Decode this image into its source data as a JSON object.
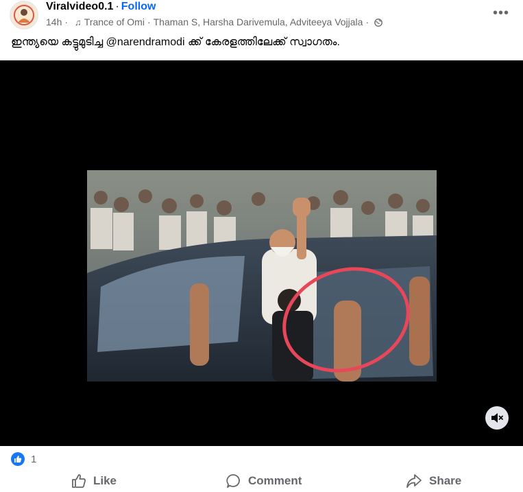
{
  "post": {
    "author": "Viralvideo0.1",
    "follow": "Follow",
    "time": "14h",
    "music": "Trance of Omi",
    "artists": "Thaman S, Harsha Darivemula, Adviteeya Vojjala",
    "dot": "·",
    "caption": "ഇന്ത്യയെ കട്ടുമുടിച്ച @narendramodi ക്ക് കേരളത്തിലേക്ക് സ്വാഗതം."
  },
  "reactions": {
    "count": "1"
  },
  "actions": {
    "like": "Like",
    "comment": "Comment",
    "share": "Share"
  },
  "icons": {
    "avatar": "avatar",
    "music": "music-note-icon",
    "globe": "globe-icon",
    "more": "more-options-icon",
    "mute": "muted-speaker-icon",
    "like_badge": "thumbs-up-icon",
    "like": "thumbs-up-icon",
    "comment": "speech-bubble-icon",
    "share": "share-arrow-icon"
  },
  "colors": {
    "accent": "#0866ff",
    "secondary_text": "#65676b",
    "annotation_circle": "#e8475a"
  }
}
